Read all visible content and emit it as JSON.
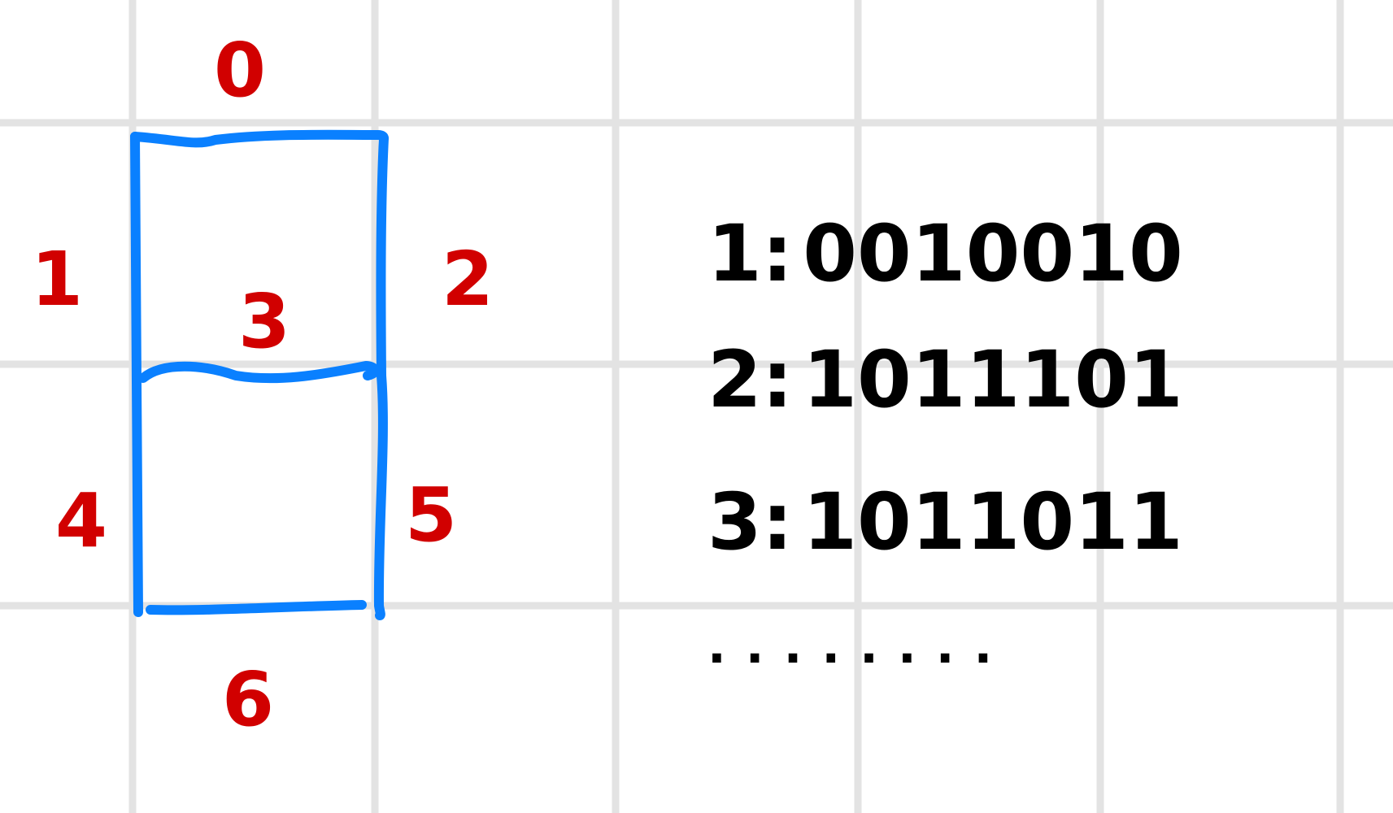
{
  "colors": {
    "grid": "#e3e3e3",
    "segment_stroke": "#0a80ff",
    "label": "#d10000",
    "text": "#000000"
  },
  "segment_labels": {
    "top": "0",
    "upper_left": "1",
    "upper_right": "2",
    "middle": "3",
    "lower_left": "4",
    "lower_right": "5",
    "bottom": "6"
  },
  "encodings": [
    {
      "digit": "1",
      "bits": "0010010"
    },
    {
      "digit": "2",
      "bits": "1011101"
    },
    {
      "digit": "3",
      "bits": "1011011"
    }
  ],
  "ellipsis": "........"
}
